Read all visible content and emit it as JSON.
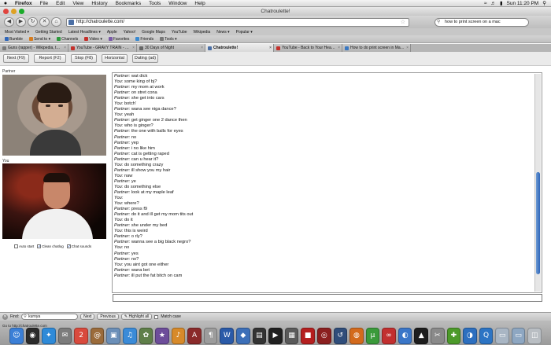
{
  "menubar": {
    "apple": "",
    "items": [
      "Firefox",
      "File",
      "Edit",
      "View",
      "History",
      "Bookmarks",
      "Tools",
      "Window",
      "Help"
    ],
    "clock": "Sun 11:20 PM"
  },
  "window": {
    "title": "Chatroulette!"
  },
  "nav": {
    "url": "http://chatroulette.com/",
    "search_value": "how to print screen on a mac"
  },
  "bookmarks": [
    "Most Visited ▾",
    "Getting Started",
    "Latest Headlines ▾",
    "Apple",
    "Yahoo!",
    "Google Maps",
    "YouTube",
    "Wikipedia",
    "News ▾",
    "Popular ▾"
  ],
  "addons": [
    "Bumble",
    "Send to ▾",
    "Channels",
    "Video ▾",
    "Favorites",
    "Friends",
    "Tools ▾"
  ],
  "tabs": [
    {
      "label": "Guns (rapper) - Wikipedia, the f...",
      "color": "#7a7a7a",
      "active": false
    },
    {
      "label": "YouTube - GRAVY TRAIN - HEL...",
      "color": "#c4302b",
      "active": false
    },
    {
      "label": "30 Days of Night",
      "color": "#666666",
      "active": false
    },
    {
      "label": "Chatroulette!",
      "color": "#4b6fa5",
      "active": true
    },
    {
      "label": "YouTube - Back to Your Head T...",
      "color": "#c4302b",
      "active": false
    },
    {
      "label": "How to do print screen in Mac ...",
      "color": "#3a78c2",
      "active": false
    }
  ],
  "actions": {
    "next": "Next (F9)",
    "report": "Report (F2)",
    "stop": "Stop (F8)",
    "horizontal": "Horizontal",
    "dating": "Dating (ad)"
  },
  "video": {
    "partner_label": "Partner",
    "you_label": "You",
    "auto_start": "Auto start",
    "clean_chatlog": "Clean chatlog",
    "chat_sounds": "Chat sounds"
  },
  "chat": [
    {
      "who": "Partner:",
      "text": "wat dick"
    },
    {
      "who": "You:",
      "text": "some king of bj?"
    },
    {
      "who": "Partner:",
      "text": "my mom at work"
    },
    {
      "who": "Partner:",
      "text": "on stret cona"
    },
    {
      "who": "Partner:",
      "text": "she get into cars"
    },
    {
      "who": "You:",
      "text": "botch'"
    },
    {
      "who": "Partner:",
      "text": "wana see niga dance?"
    },
    {
      "who": "You:",
      "text": "yeah"
    },
    {
      "who": "Partner:",
      "text": "get ginger one 2 dance then"
    },
    {
      "who": "You:",
      "text": "who is ginger?"
    },
    {
      "who": "Partner:",
      "text": "the one with balls for eyes"
    },
    {
      "who": "Partner:",
      "text": "no"
    },
    {
      "who": "Partner:",
      "text": "yep"
    },
    {
      "who": "Partner:",
      "text": "i no like him"
    },
    {
      "who": "Partner:",
      "text": "cat is getting raped"
    },
    {
      "who": "Partner:",
      "text": "can u hear it?"
    },
    {
      "who": "You:",
      "text": "do something crazy"
    },
    {
      "who": "Partner:",
      "text": "ill show you my hair"
    },
    {
      "who": "You:",
      "text": "naw"
    },
    {
      "who": "Partner:",
      "text": "ye"
    },
    {
      "who": "You:",
      "text": "do something else"
    },
    {
      "who": "Partner:",
      "text": "look at my maple leaf"
    },
    {
      "who": "You:",
      "text": ""
    },
    {
      "who": "You:",
      "text": "where?"
    },
    {
      "who": "Partner:",
      "text": "press f9"
    },
    {
      "who": "Partner:",
      "text": "do it and ill get my mom tits out"
    },
    {
      "who": "You:",
      "text": "do it"
    },
    {
      "who": "Partner:",
      "text": "she under my bed"
    },
    {
      "who": "You:",
      "text": "this is weird"
    },
    {
      "who": "Partner:",
      "text": "o rly?"
    },
    {
      "who": "Partner:",
      "text": "wanna see a big black negro?"
    },
    {
      "who": "You:",
      "text": "no"
    },
    {
      "who": "Partner:",
      "text": "yes"
    },
    {
      "who": "Partner:",
      "text": "no?"
    },
    {
      "who": "You:",
      "text": "you aint got one either"
    },
    {
      "who": "Partner:",
      "text": "wana bet"
    },
    {
      "who": "Partner:",
      "text": "ill put the fat bitch on cam"
    }
  ],
  "findbar": {
    "label": "Find:",
    "value": "kurnya",
    "next": "Next",
    "previous": "Previous",
    "highlight": "Highlight all",
    "match_case": "Match case"
  },
  "status": {
    "text": "Go to http://chatroulette.com"
  },
  "dock": [
    {
      "icon": "finder-icon",
      "glyph": "☺",
      "color": "#3b7fd6"
    },
    {
      "icon": "dashboard-icon",
      "glyph": "◉",
      "color": "#2b2b2b"
    },
    {
      "icon": "safari-icon",
      "glyph": "✦",
      "color": "#2e8ad8"
    },
    {
      "icon": "mail-icon",
      "glyph": "✉",
      "color": "#7c7c7c"
    },
    {
      "icon": "ical-icon",
      "glyph": "2",
      "color": "#d94a3d"
    },
    {
      "icon": "addressbook-icon",
      "glyph": "@",
      "color": "#9b6b3a"
    },
    {
      "icon": "preview-icon",
      "glyph": "▣",
      "color": "#6b8fb8"
    },
    {
      "icon": "itunes-icon",
      "glyph": "♫",
      "color": "#3b8bd8"
    },
    {
      "icon": "iphoto-icon",
      "glyph": "✿",
      "color": "#5f7f49"
    },
    {
      "icon": "imovie-icon",
      "glyph": "★",
      "color": "#6d4d9a"
    },
    {
      "icon": "garageband-icon",
      "glyph": "♪",
      "color": "#d78a2a"
    },
    {
      "icon": "dictionary-icon",
      "glyph": "A",
      "color": "#8a2a2a"
    },
    {
      "icon": "textedit-icon",
      "glyph": "¶",
      "color": "#9c9c9c"
    },
    {
      "icon": "word-icon",
      "glyph": "W",
      "color": "#2a5aa8"
    },
    {
      "icon": "keynote-icon",
      "glyph": "◆",
      "color": "#3c6fb8"
    },
    {
      "icon": "clapper-icon",
      "glyph": "▤",
      "color": "#333333"
    },
    {
      "icon": "film-icon",
      "glyph": "▶",
      "color": "#202020"
    },
    {
      "icon": "stocks-icon",
      "glyph": "▦",
      "color": "#5a5a5a"
    },
    {
      "icon": "redbook-icon",
      "glyph": "■",
      "color": "#b51f1f"
    },
    {
      "icon": "photobooth-icon",
      "glyph": "◎",
      "color": "#8b1f1f"
    },
    {
      "icon": "timemachine-icon",
      "glyph": "↺",
      "color": "#2f4d7a"
    },
    {
      "icon": "firefox-icon",
      "glyph": "◍",
      "color": "#d36a1c"
    },
    {
      "icon": "bittorrent-icon",
      "glyph": "µ",
      "color": "#3a9a3a"
    },
    {
      "icon": "adobe-icon",
      "glyph": "∞",
      "color": "#c22f2f"
    },
    {
      "icon": "globe-icon",
      "glyph": "◐",
      "color": "#3a76c8"
    },
    {
      "icon": "frontrow-icon",
      "glyph": "▲",
      "color": "#1d1d1d"
    },
    {
      "icon": "tools-icon",
      "glyph": "✂",
      "color": "#8a8a8a"
    },
    {
      "icon": "xbox-icon",
      "glyph": "✚",
      "color": "#4c9a2a"
    },
    {
      "icon": "globe2-icon",
      "glyph": "◑",
      "color": "#2d6fbf"
    },
    {
      "icon": "quicktime-icon",
      "glyph": "Q",
      "color": "#2c74c4"
    },
    {
      "icon": "documents-icon",
      "glyph": "▭",
      "color": "#a9b6c4"
    },
    {
      "icon": "downloads-icon",
      "glyph": "▭",
      "color": "#8ea7c2"
    },
    {
      "icon": "trash-icon",
      "glyph": "◫",
      "color": "#b9bec3"
    }
  ]
}
